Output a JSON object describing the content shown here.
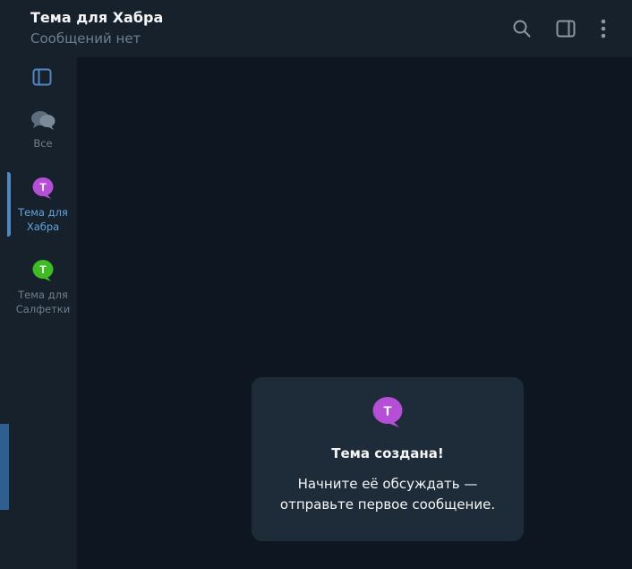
{
  "header": {
    "title": "Тема для Хабра",
    "subtitle": "Сообщений нет",
    "icons": {
      "search": "search-icon",
      "sidebar": "sidebar-panel-icon",
      "menu": "more-vertical-icon"
    }
  },
  "sidebar": {
    "toggle_icon": "sidebar-panel-icon",
    "items": [
      {
        "label": "Все",
        "icon": "chats-icon",
        "active": false
      },
      {
        "label": "Тема для\nХабра",
        "icon": "topic-bubble-icon",
        "letter": "Т",
        "color": "#b44fd6",
        "active": true
      },
      {
        "label": "Тема для\nСалфетки",
        "icon": "topic-bubble-icon",
        "letter": "Т",
        "color": "#3fbb24",
        "active": false
      }
    ]
  },
  "empty_state": {
    "icon_letter": "Т",
    "icon_color": "#b44fd6",
    "title": "Тема создана!",
    "text_line1": "Начните её обсуждать —",
    "text_line2": "отправьте первое сообщение."
  },
  "colors": {
    "background": "#0e1621",
    "panel": "#17212b",
    "card": "#1e2c3a",
    "accent": "#5288c1",
    "muted_text": "#6d7f8f"
  }
}
